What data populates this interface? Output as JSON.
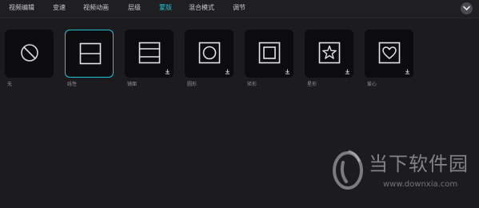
{
  "tabs": [
    {
      "label": "视频编辑"
    },
    {
      "label": "变速"
    },
    {
      "label": "视频动画"
    },
    {
      "label": "层级"
    },
    {
      "label": "蒙版",
      "active": true
    },
    {
      "label": "混合模式"
    },
    {
      "label": "调节"
    }
  ],
  "masks": [
    {
      "label": "无",
      "icon": "none-circle-slash-icon",
      "selected": false,
      "download": false
    },
    {
      "label": "线性",
      "icon": "linear-mask-icon",
      "selected": true,
      "download": false
    },
    {
      "label": "镜面",
      "icon": "mirror-mask-icon",
      "selected": false,
      "download": true
    },
    {
      "label": "圆形",
      "icon": "circle-mask-icon",
      "selected": false,
      "download": true
    },
    {
      "label": "矩形",
      "icon": "rectangle-mask-icon",
      "selected": false,
      "download": true
    },
    {
      "label": "星形",
      "icon": "star-mask-icon",
      "selected": false,
      "download": true
    },
    {
      "label": "爱心",
      "icon": "heart-mask-icon",
      "selected": false,
      "download": true
    }
  ],
  "watermark": {
    "title": "当下软件园",
    "url": "www.downxia.com"
  },
  "colors": {
    "accent": "#1bc7d8",
    "background": "#1c1c1f",
    "tile": "#0c0c0e"
  }
}
